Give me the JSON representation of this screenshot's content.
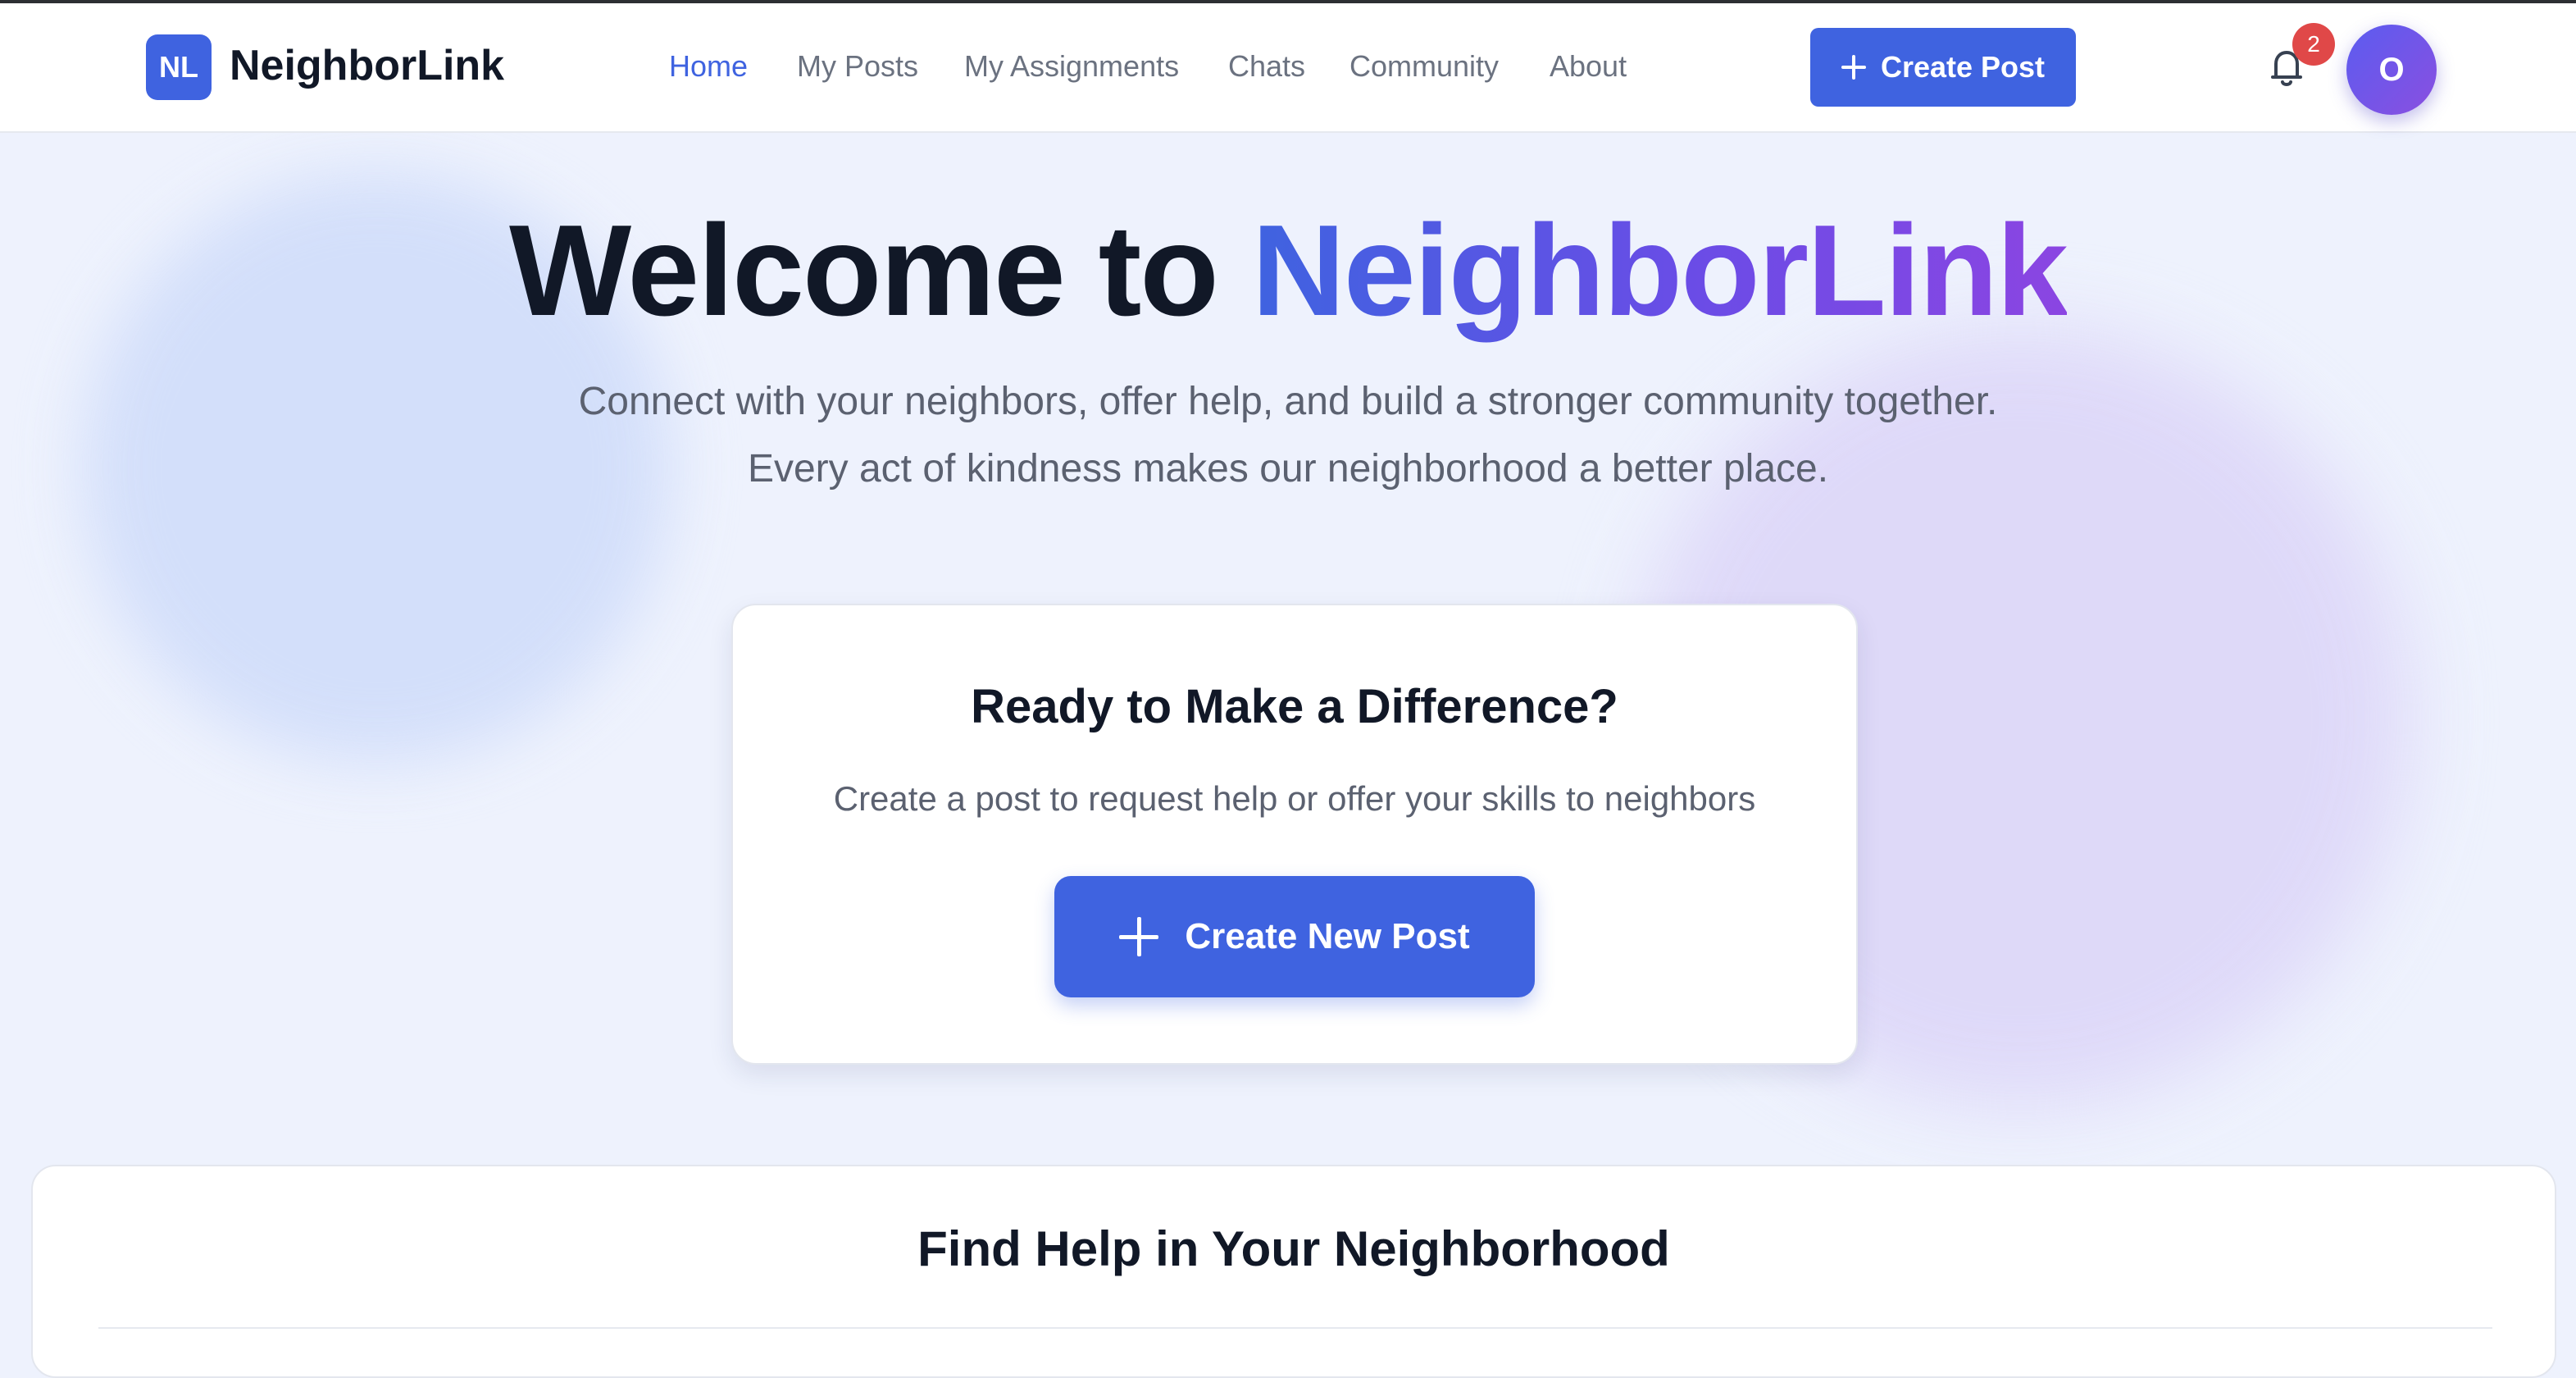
{
  "brand": {
    "badge": "NL",
    "name": "NeighborLink"
  },
  "nav": {
    "links": [
      {
        "label": "Home",
        "active": true
      },
      {
        "label": "My Posts",
        "active": false
      },
      {
        "label": "My Assignments",
        "active": false
      },
      {
        "label": "Chats",
        "active": false
      },
      {
        "label": "Community",
        "active": false
      },
      {
        "label": "About",
        "active": false
      }
    ],
    "create_post_label": "Create Post",
    "notifications_count": "2",
    "avatar_initial": "O"
  },
  "hero": {
    "title_prefix": "Welcome to ",
    "title_highlight": "NeighborLink",
    "subtitle_line1": "Connect with your neighbors, offer help, and build a stronger community together.",
    "subtitle_line2": "Every act of kindness makes our neighborhood a better place."
  },
  "cta_card": {
    "title": "Ready to Make a Difference?",
    "subtitle": "Create a post to request help or offer your skills to neighbors",
    "button_label": "Create New Post"
  },
  "find_section": {
    "title": "Find Help in Your Neighborhood"
  },
  "colors": {
    "accent": "#3f63e0",
    "gradient_end": "#8b45e2",
    "badge_red": "#e04848",
    "text_dark": "#111827",
    "text_muted": "#5b6170"
  },
  "icons": {
    "create_post": "plus-icon",
    "notifications": "bell-icon"
  }
}
